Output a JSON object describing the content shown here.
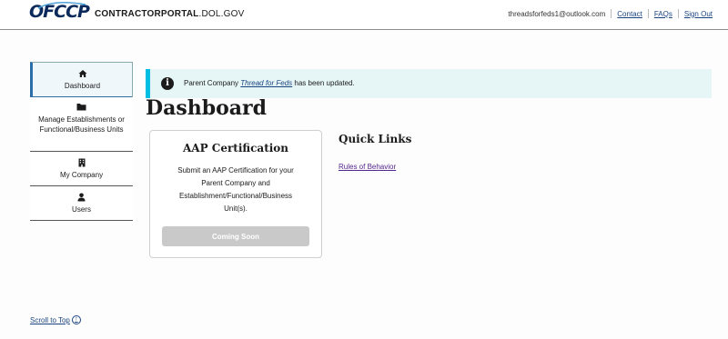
{
  "header": {
    "logo_text": "OFCCP",
    "site_name_bold": "CONTRACTORPORTAL",
    "site_name_rest": ".DOL.GOV",
    "user_email": "threadsforfeds1@outlook.com",
    "links": [
      "Contact",
      "FAQs",
      "Sign Out"
    ]
  },
  "sidebar": {
    "items": [
      {
        "label": "Dashboard",
        "icon": "home-icon",
        "active": true
      },
      {
        "label": "Manage Establishments or Functional/Business Units",
        "icon": "folder-icon",
        "active": false
      },
      {
        "label": "My Company",
        "icon": "building-icon",
        "active": false
      },
      {
        "label": "Users",
        "icon": "user-icon",
        "active": false
      }
    ]
  },
  "alert": {
    "prefix": "Parent Company ",
    "link_text": "Thread for Feds",
    "suffix": " has been updated."
  },
  "page_title": "Dashboard",
  "card": {
    "title": "AAP Certification",
    "body": "Submit an AAP Certification for your Parent Company and Establishment/Functional/Business Unit(s).",
    "button_label": "Coming Soon"
  },
  "quick_links": {
    "title": "Quick Links",
    "links": [
      "Rules of Behavior"
    ]
  },
  "footer": {
    "scroll_top": "Scroll to Top"
  },
  "colors": {
    "accent": "#00bde3",
    "link": "#1a4480",
    "visited_link": "#54278f",
    "disabled_button": "#c9c9c9"
  }
}
